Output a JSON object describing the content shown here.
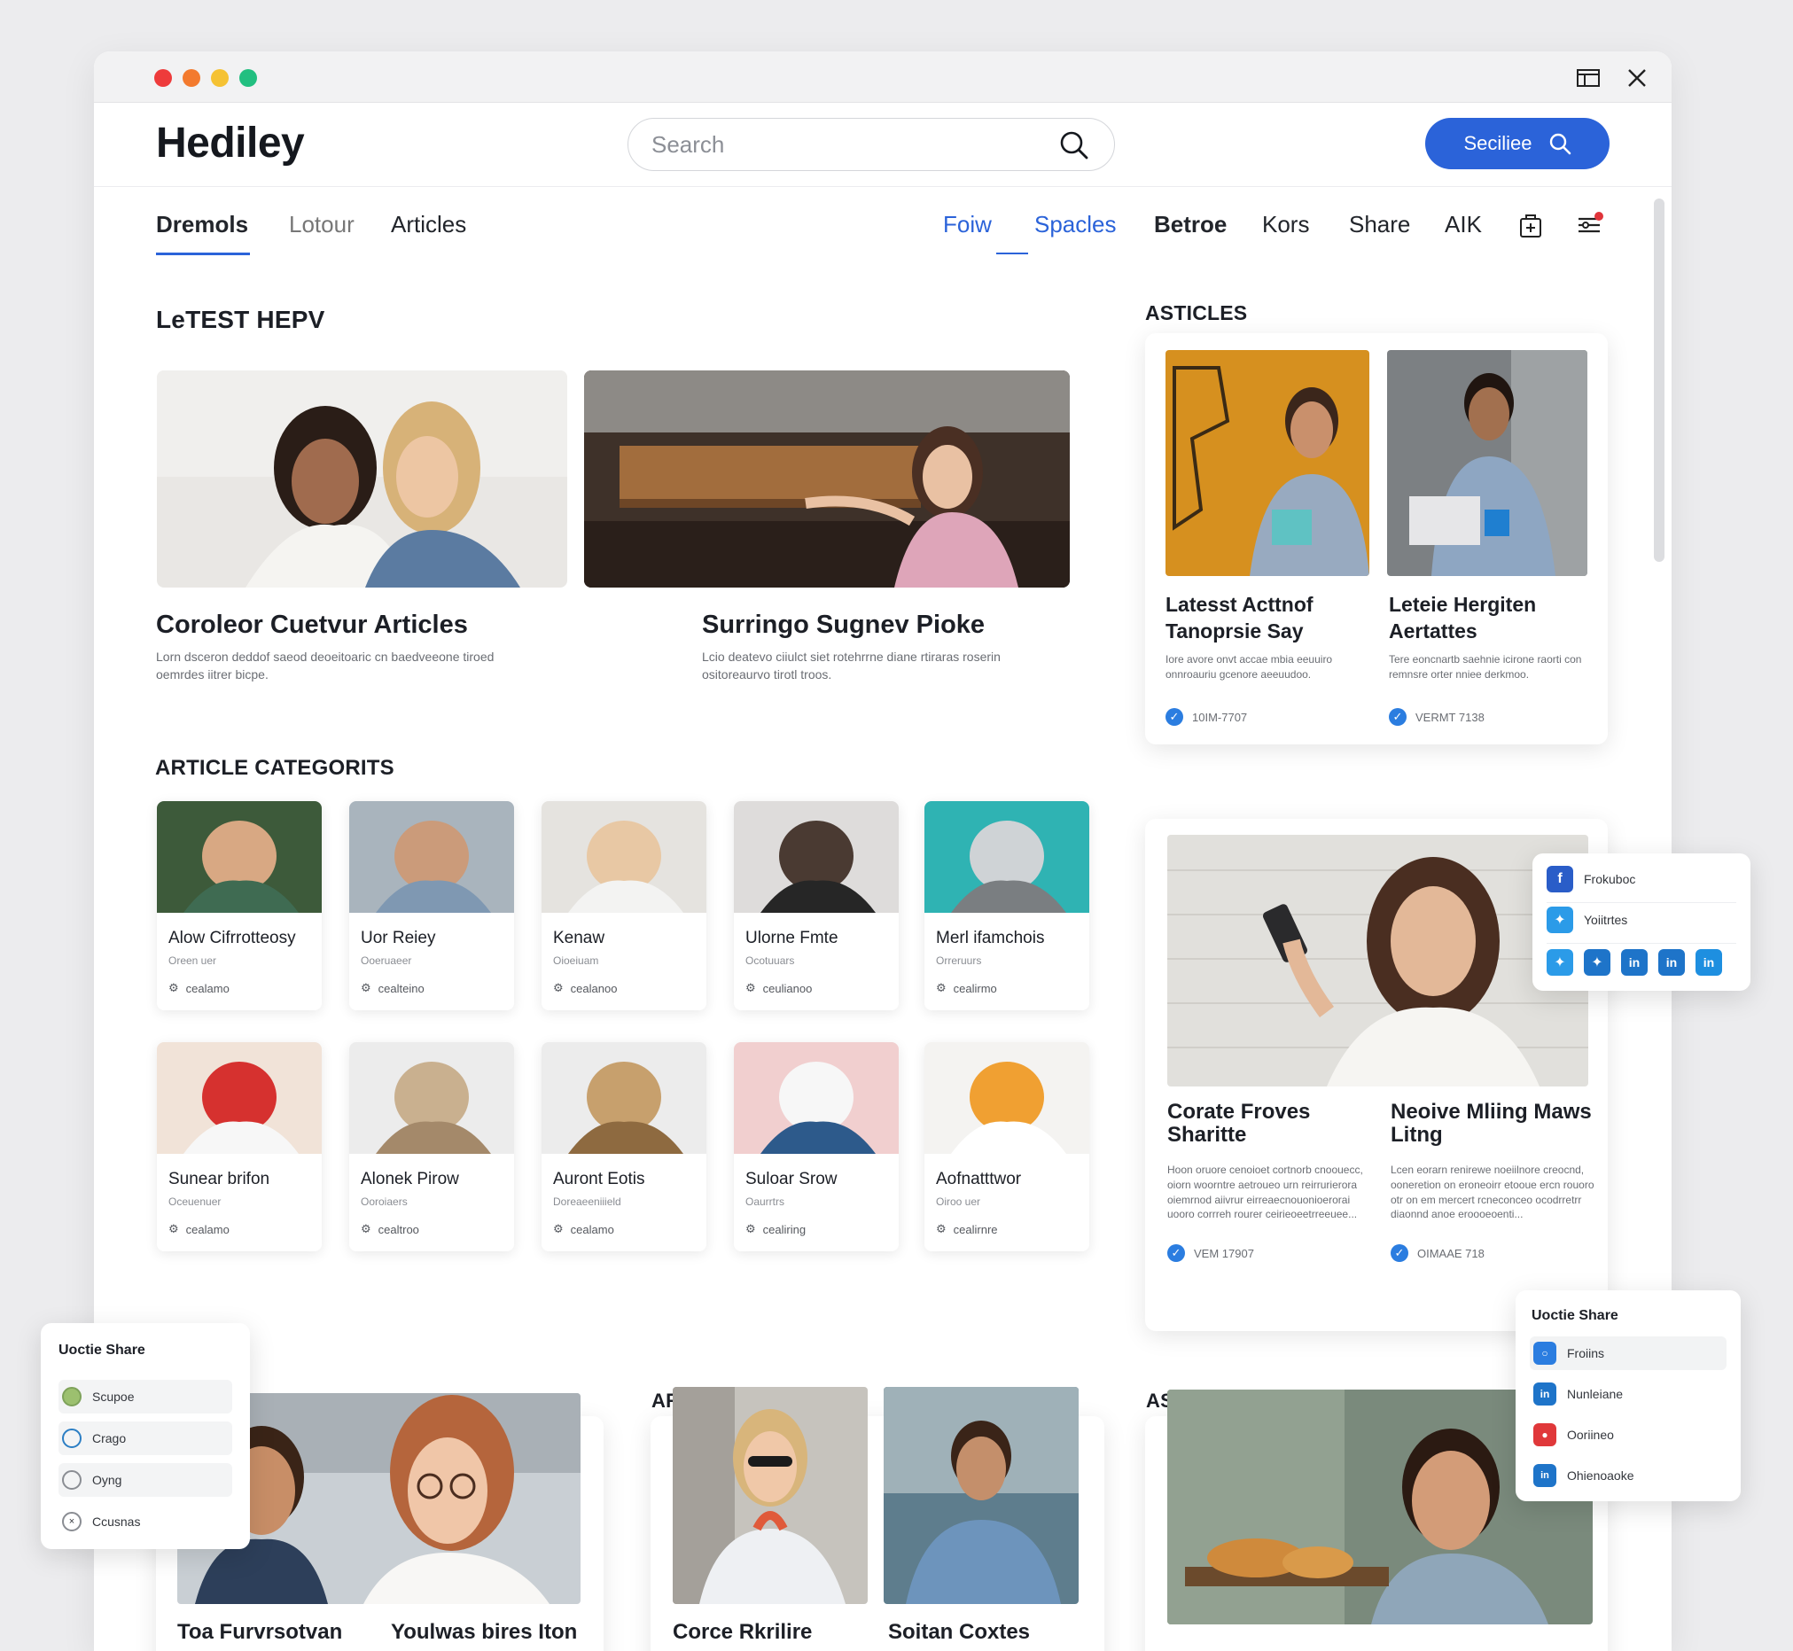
{
  "window": {
    "controls": [
      "close",
      "minimize",
      "maximize",
      "fullscreen"
    ]
  },
  "header": {
    "logo": "Hediley",
    "search_placeholder": "Search",
    "primary_button": "Seciliee"
  },
  "nav": {
    "left_tabs": [
      "Dremols",
      "Lotour",
      "Articles"
    ],
    "right_tabs": [
      "Foiw",
      "Spacles",
      "Betroe",
      "Kors",
      "Share",
      "AIK"
    ],
    "active_left": "Dremols",
    "active_right": "Foiw"
  },
  "latest": {
    "title": "LeTEST HEPV",
    "items": [
      {
        "title": "Coroleor Cuetvur Articles",
        "desc": "Lorn dsceron deddof saeod deoeitoaric cn baedveeone tiroed oemrdes iitrer bicpe."
      },
      {
        "title": "Surringo Sugnev Pioke",
        "desc": "Lcio deatevo ciiulct siet rotehrrne diane rtiraras roserin ositoreaurvo tirotl troos."
      }
    ]
  },
  "sidebar_articles": {
    "title": "ASTICLES",
    "items": [
      {
        "title": "Latesst Acttnof Tanoprsie Say",
        "desc": "Iore avore onvt accae mbia eeuuiro onnroauriu gcenore aeeuudoo.",
        "meta": "10IM-7707"
      },
      {
        "title": "Leteie Hergiten Aertattes",
        "desc": "Tere eoncnartb saehnie icirone raorti con remnsre orter nniee derkmoo.",
        "meta": "VERMT 7138"
      }
    ]
  },
  "categories": {
    "title": "ARTICLE CATEGORITS",
    "items": [
      {
        "title": "Alow Cifrrotteosy",
        "sub": "Oreen uer",
        "foot": "cealamo"
      },
      {
        "title": "Uor Reiey",
        "sub": "Ooeruaeer",
        "foot": "cealteino"
      },
      {
        "title": "Kenaw",
        "sub": "Oioeiuam",
        "foot": "cealanoo"
      },
      {
        "title": "Ulorne Fmte",
        "sub": "Ocotuuars",
        "foot": "ceulianoo"
      },
      {
        "title": "Merl ifamchois",
        "sub": "Orreruurs",
        "foot": "cealirmo"
      },
      {
        "title": "Sunear brifon",
        "sub": "Oceuenuer",
        "foot": "cealamo"
      },
      {
        "title": "Alonek Pirow",
        "sub": "Ooroiaers",
        "foot": "cealtroo"
      },
      {
        "title": "Auront Eotis",
        "sub": "Doreaeeniiield",
        "foot": "cealamo"
      },
      {
        "title": "Suloar Srow",
        "sub": "Oaurrtrs",
        "foot": "cealiring"
      },
      {
        "title": "Aofnatttwor",
        "sub": "Oiroo uer",
        "foot": "cealirnre"
      }
    ]
  },
  "feature": {
    "items": [
      {
        "title": "Corate Froves Sharitte",
        "desc": "Hoon oruore cenoioet cortnorb cnoouecc, oiorn woorntre aetroueo urn reirrurierora oiemrnod aiivrur eirreaecnouonioerorai uooro corrreh rourer ceirieoeetrreeuee...",
        "meta": "VEM 17907"
      },
      {
        "title": "Neoive Mliing Maws Litng",
        "desc": "Lcen eorarn renirewe noeiilnore creocnd, ooneretion on eroneoirr etooue ercn rouoro otr on em mercert rcneconceo ocodrretrr diaonnd anoe eroooeoenti...",
        "meta": "OIMAAE 718"
      }
    ]
  },
  "share_popup": {
    "items": [
      "Frokuboc",
      "Yoiitrtes"
    ],
    "icons": [
      "twitter",
      "twitter",
      "linkedin",
      "linkedin",
      "linkedin"
    ]
  },
  "left_popup": {
    "title": "Uoctie Share",
    "items": [
      "Scupoe",
      "Crago",
      "Oyng",
      "Ccusnas"
    ]
  },
  "right_popup": {
    "title": "Uoctie Share",
    "items": [
      "Froiins",
      "Nunleiane",
      "Ooriineo",
      "Ohienoaoke"
    ]
  },
  "bottom": {
    "sections": [
      "S",
      "ARTICLES",
      "ASTICLS"
    ],
    "titles": [
      "Toa Furvrsotvan",
      "Youlwas bires Iton",
      "Corce Rkrilire",
      "Soitan Coxtes"
    ]
  },
  "colors": {
    "accent": "#2b63d9",
    "nav_active": "#2b63d9"
  }
}
